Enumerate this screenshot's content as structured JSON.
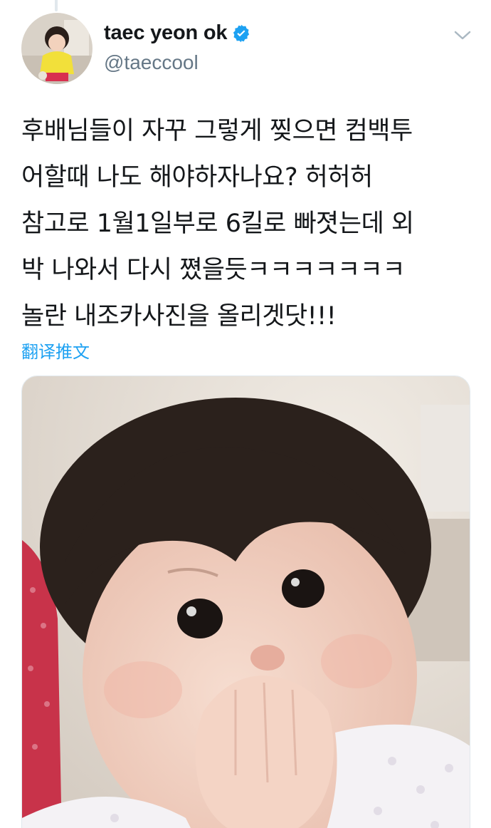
{
  "tweet": {
    "author": {
      "display_name": "taec yeon ok",
      "handle": "@taeccool",
      "verified": true,
      "avatar_icon": "profile-photo"
    },
    "text_lines": [
      "후배님들이 자꾸 그렇게 찢으면 컴백투",
      "어할때 나도 해야하자나요? 허허허",
      "참고로 1월1일부로 6킬로 빠졋는데 외",
      "박 나와서 다시 쪘을듯ㅋㅋㅋㅋㅋㅋㅋ",
      "놀란 내조카사진을 올리겟닷!!!"
    ],
    "translate_label": "翻译推文",
    "media_icon": "baby-photo"
  },
  "colors": {
    "link": "#1da1f2",
    "verified": "#1da1f2",
    "secondary_text": "#657786",
    "primary_text": "#14171a"
  }
}
